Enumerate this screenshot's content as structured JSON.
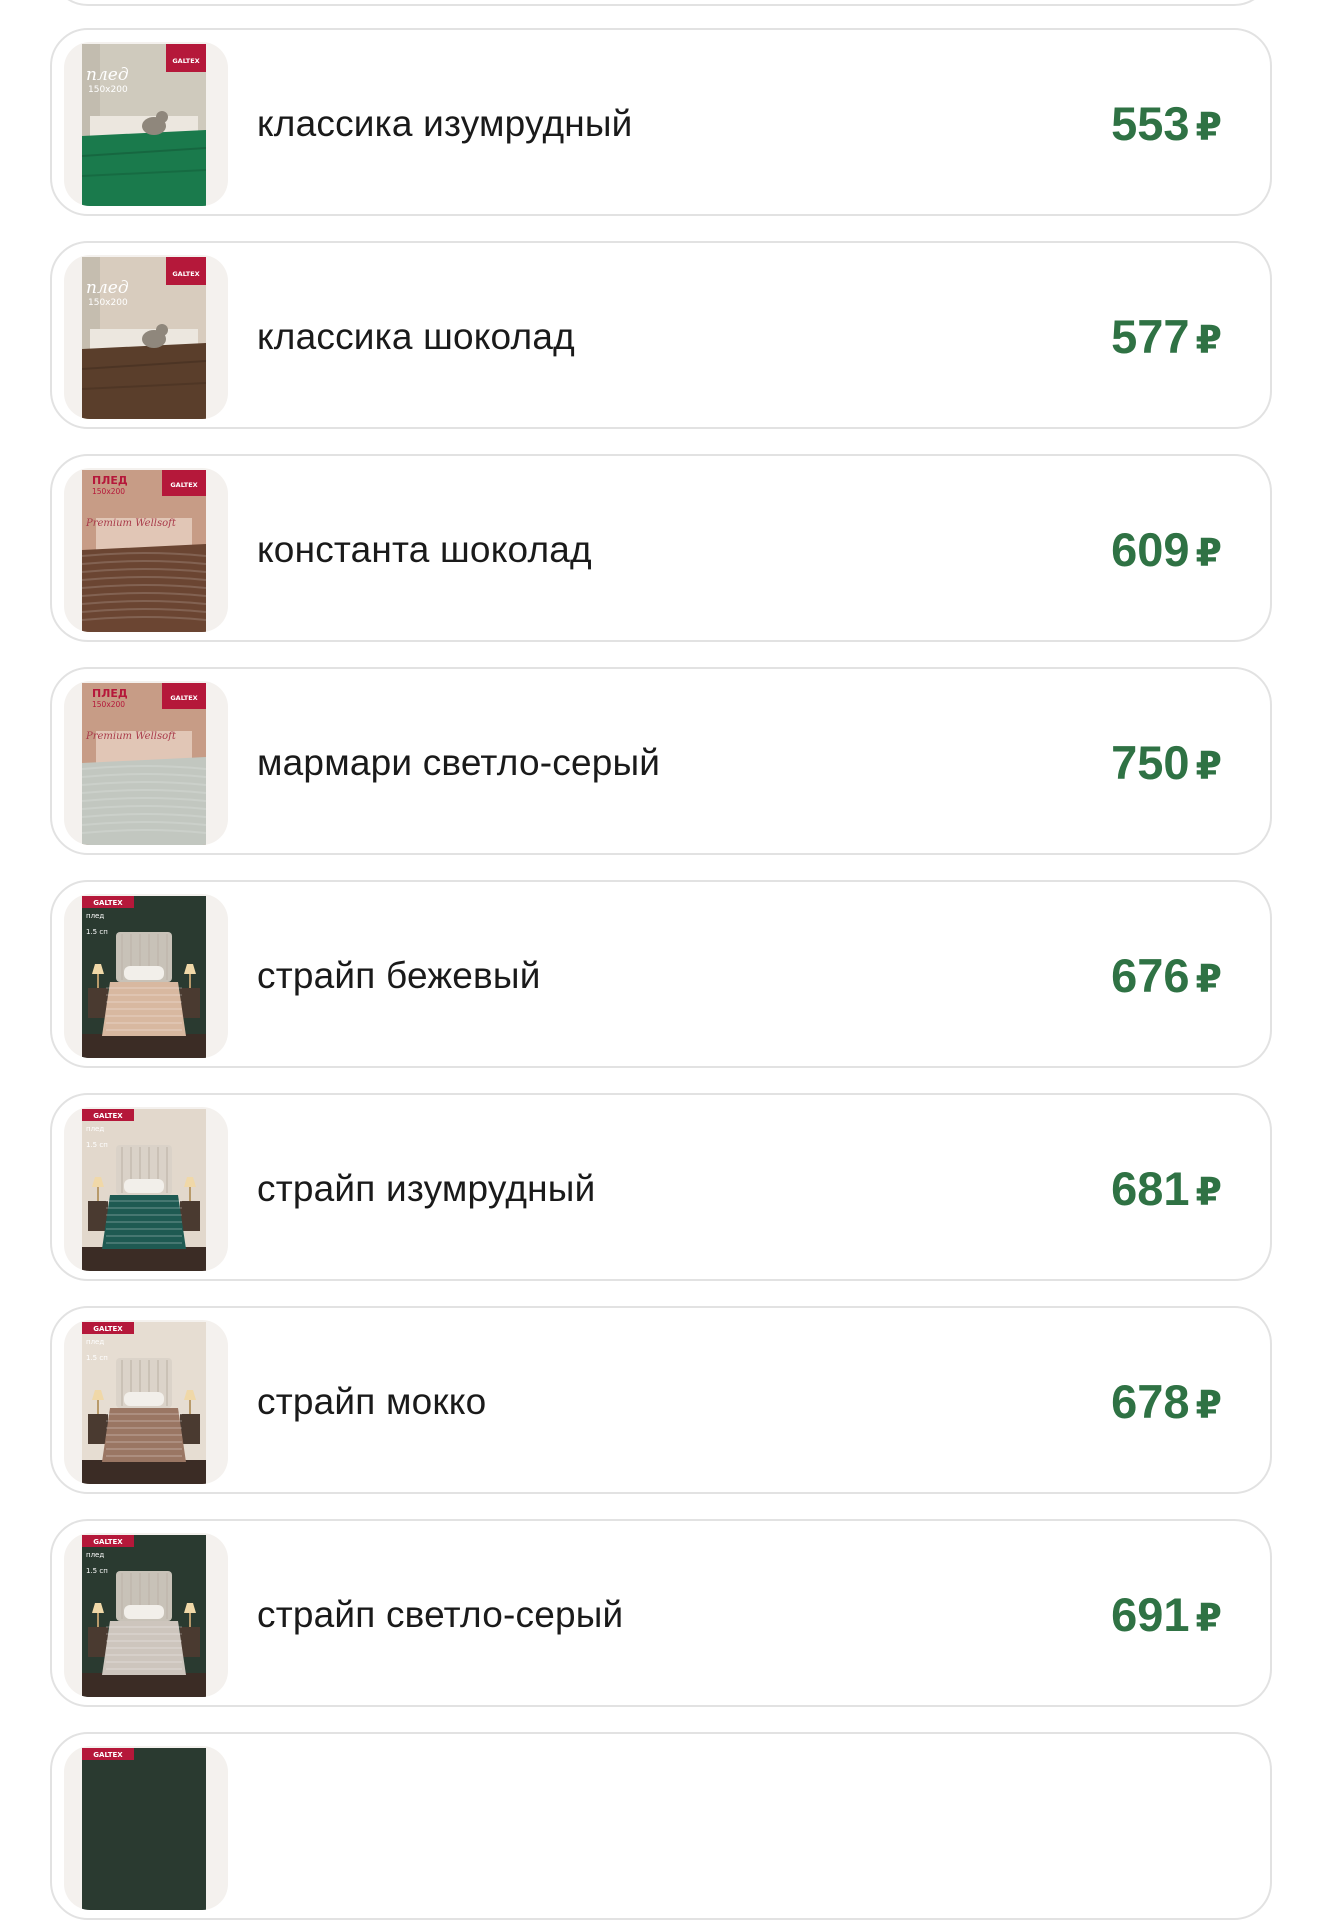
{
  "products": [
    {
      "name": "классика изумрудный",
      "price": "553",
      "currency": "₽",
      "image": {
        "style": "classic",
        "brand": "GALTEX",
        "label": "плед",
        "size": "150x200",
        "blanket_color": "#1a7a4c",
        "wall_color": "#cfcabd",
        "pet": "cat"
      }
    },
    {
      "name": "классика шоколад",
      "price": "577",
      "currency": "₽",
      "image": {
        "style": "classic",
        "brand": "GALTEX",
        "label": "плед",
        "size": "150x200",
        "blanket_color": "#5a3e2b",
        "wall_color": "#d8ccbe",
        "pet": "cat"
      }
    },
    {
      "name": "константа шоколад",
      "price": "609",
      "currency": "₽",
      "image": {
        "style": "premium",
        "brand": "GALTEX",
        "label": "ПЛЕД",
        "size": "150x200",
        "script": "Premium Wellsoft",
        "blanket_color": "#6b4532",
        "wall_color": "#c79c86"
      }
    },
    {
      "name": "мармари светло-серый",
      "price": "750",
      "currency": "₽",
      "image": {
        "style": "premium",
        "brand": "GALTEX",
        "label": "ПЛЕД",
        "size": "150x200",
        "script": "Premium Wellsoft",
        "blanket_color": "#c2c7c0",
        "wall_color": "#c79c86"
      }
    },
    {
      "name": "страйп бежевый",
      "price": "676",
      "currency": "₽",
      "image": {
        "style": "room",
        "brand": "GALTEX",
        "label": "плед",
        "size": "1.5 сп",
        "blanket_color": "#d8b8a0",
        "wall_color": "#2a3a30"
      }
    },
    {
      "name": "страйп изумрудный",
      "price": "681",
      "currency": "₽",
      "image": {
        "style": "room",
        "brand": "GALTEX",
        "label": "плед",
        "size": "1.5 сп",
        "blanket_color": "#1e5a52",
        "wall_color": "#e2d8cc"
      }
    },
    {
      "name": "страйп мокко",
      "price": "678",
      "currency": "₽",
      "image": {
        "style": "room",
        "brand": "GALTEX",
        "label": "плед",
        "size": "1.5 сп",
        "blanket_color": "#9a7663",
        "wall_color": "#e6ddd2"
      }
    },
    {
      "name": "страйп светло-серый",
      "price": "691",
      "currency": "₽",
      "image": {
        "style": "room",
        "brand": "GALTEX",
        "label": "плед",
        "size": "1.5 сп",
        "blanket_color": "#cdc5bd",
        "wall_color": "#2a3a30"
      }
    }
  ],
  "partial_bottom_item": {
    "image": {
      "brand": "GALTEX"
    }
  },
  "colors": {
    "price": "#2f7244",
    "text": "#1a1a1a",
    "border": "#e2e2e2",
    "brand_red": "#b5183a"
  }
}
